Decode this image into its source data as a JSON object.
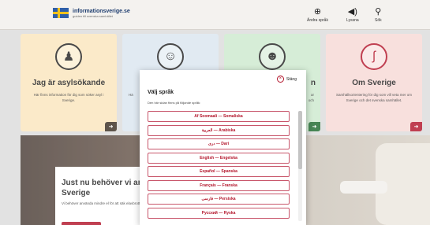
{
  "header": {
    "logo_title": "informationsverige.se",
    "logo_subtitle": "guiden till svenska samhället",
    "buttons": [
      {
        "icon": "globe-icon",
        "label": "Ändra språk"
      },
      {
        "icon": "speaker-icon",
        "label": "Lyssna"
      },
      {
        "icon": "search-icon",
        "label": "Sök"
      }
    ]
  },
  "cards": [
    {
      "title": "Jag är asylsökande",
      "text": "Här finns information för dig som söker asyl i Sverige.",
      "color": "#fbe6bd",
      "arrow_color": "#3a2f24"
    },
    {
      "title": "",
      "text": "Hä",
      "color": "#dbe6ef",
      "arrow_color": "#23425f"
    },
    {
      "title": "n",
      "text": "ar\noch",
      "color": "#cde9cf",
      "arrow_color": "#1f6b2f"
    },
    {
      "title": "Om Sverige",
      "text": "Samhällsorientering för dig som vill veta mer om Sverige och det svenska samhället.",
      "color": "#f7d9d6",
      "arrow_color": "#b3152b"
    }
  ],
  "hero": {
    "title": "Just nu behöver vi anv Sverige",
    "text": "Vi behöver använda mindre el för att säk elavbrott."
  },
  "modal": {
    "close_label": "Stäng",
    "title": "Välj språk",
    "description": "Den här sidan finns på följande språk:",
    "languages": [
      "Af Soomaali — Somaliska",
      "العربية — Arabiska",
      "دری — Dari",
      "English — Engelska",
      "Español — Spanska",
      "Français — Franska",
      "فارسی — Persiska",
      "Русский — Ryska"
    ]
  },
  "colors": {
    "accent": "#b3152b"
  }
}
